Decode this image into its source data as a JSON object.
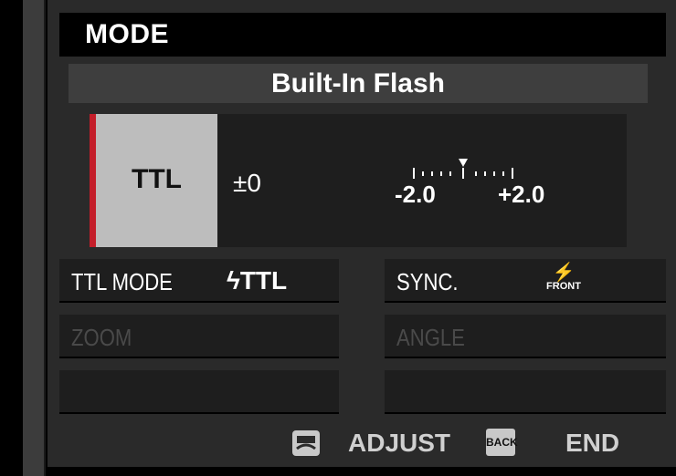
{
  "header": {
    "title": "MODE"
  },
  "flash": {
    "title": "Built-In Flash"
  },
  "mode_selection": {
    "selected": "TTL",
    "compensation": "±0"
  },
  "scale": {
    "min_label": "-2.0",
    "max_label": "+2.0",
    "value": 0
  },
  "settings": [
    {
      "label": "TTL MODE",
      "value": "ϟTTL",
      "enabled": true
    },
    {
      "label": "SYNC.",
      "value": "FRONT",
      "enabled": true
    },
    {
      "label": "ZOOM",
      "value": "",
      "enabled": false
    },
    {
      "label": "ANGLE",
      "value": "",
      "enabled": false
    }
  ],
  "footer": {
    "adjust_label": "ADJUST",
    "back_label": "BACK",
    "end_label": "END"
  },
  "colors": {
    "accent": "#c41e2a",
    "selected_bg": "#bdbdbd",
    "panel_bg": "#1e1e1e"
  },
  "icons": {
    "sync": "flash-front-icon",
    "adjust": "command-dial-icon",
    "back": "back-button-icon"
  }
}
